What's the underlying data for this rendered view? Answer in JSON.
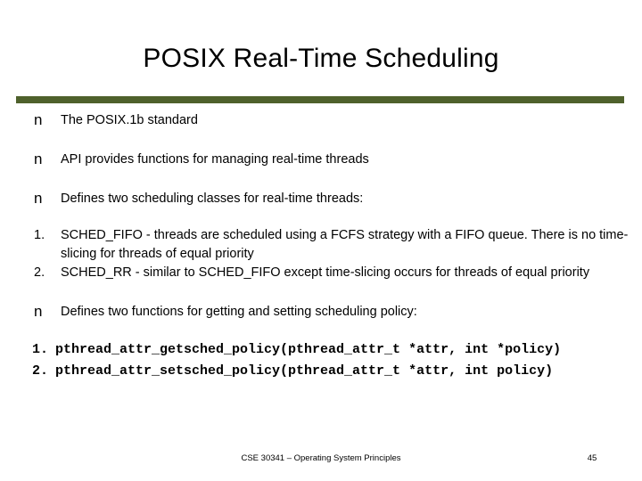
{
  "slide": {
    "title": "POSIX Real-Time Scheduling",
    "accent_color": "#4F612C",
    "background_color": "#ffffff",
    "text_color": "#000000",
    "bullet_glyph": "n"
  },
  "content": {
    "bullets": [
      {
        "glyph": "n",
        "text": "The POSIX.1b standard"
      },
      {
        "glyph": "n",
        "text": "API provides functions for managing real-time threads"
      },
      {
        "glyph": "n",
        "text": "Defines two scheduling classes for real-time threads:"
      }
    ],
    "numbered_classes": [
      {
        "marker": "1.",
        "text": "SCHED_FIFO - threads are scheduled using a FCFS strategy with a FIFO queue. There is no time-slicing for threads of equal priority"
      },
      {
        "marker": "2.",
        "text": "SCHED_RR - similar to SCHED_FIFO except time-slicing occurs for threads of equal priority"
      }
    ],
    "functions_bullet": {
      "glyph": "n",
      "text": "Defines two functions for getting and setting scheduling policy:"
    },
    "numbered_functions": [
      {
        "marker": "1.",
        "text": "pthread_attr_getsched_policy(pthread_attr_t *attr, int *policy)"
      },
      {
        "marker": "2.",
        "text": "pthread_attr_setsched_policy(pthread_attr_t *attr, int policy)"
      }
    ]
  },
  "footer": {
    "course": "CSE 30341 – Operating System Principles",
    "page_number": "45"
  }
}
